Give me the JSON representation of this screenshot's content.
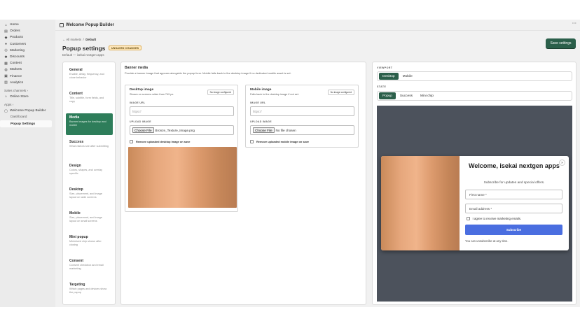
{
  "sidebar": {
    "items": [
      {
        "label": "Home",
        "icon": "home-icon"
      },
      {
        "label": "Orders",
        "icon": "orders-icon"
      },
      {
        "label": "Products",
        "icon": "products-icon"
      },
      {
        "label": "Customers",
        "icon": "customers-icon"
      },
      {
        "label": "Marketing",
        "icon": "marketing-icon"
      },
      {
        "label": "Discounts",
        "icon": "discounts-icon"
      },
      {
        "label": "Content",
        "icon": "content-icon"
      },
      {
        "label": "Markets",
        "icon": "markets-icon"
      },
      {
        "label": "Finance",
        "icon": "finance-icon"
      },
      {
        "label": "Analytics",
        "icon": "analytics-icon"
      }
    ],
    "sales_channels_label": "Sales channels",
    "online_store": "Online Store",
    "apps_label": "Apps",
    "app_name": "Welcome Popup Builder",
    "app_sub": [
      "Dashboard",
      "Popup Settings"
    ]
  },
  "appbar": {
    "title": "Welcome Popup Builder",
    "more": "···"
  },
  "header": {
    "breadcrumb_back": "← All markets",
    "breadcrumb_sep": "/",
    "breadcrumb_current": "Default",
    "title": "Popup settings",
    "unsaved_badge": "UNSAVED CHANGES",
    "subtitle": "Default — isekai nextgen apps",
    "save_label": "Save settings"
  },
  "settings_menu": [
    {
      "title": "General",
      "desc": "Enable, delay, frequency, and close behavior"
    },
    {
      "title": "Content",
      "desc": "Title, subtitle, form fields, and copy"
    },
    {
      "title": "Media",
      "desc": "Banner images for desktop and mobile"
    },
    {
      "title": "Success",
      "desc": "What visitors see after submitting"
    },
    {
      "title": "Design",
      "desc": "Colors, shapes, and overlay specific"
    },
    {
      "title": "Desktop",
      "desc": "Size, placement, and image layout on wide screens"
    },
    {
      "title": "Mobile",
      "desc": "Size, placement, and image layout on small screens"
    },
    {
      "title": "Mini popup",
      "desc": "Minimized chip shown after closing"
    },
    {
      "title": "Consent",
      "desc": "Consent checkbox and email marketing"
    },
    {
      "title": "Targeting",
      "desc": "Which pages and devices show the popup"
    }
  ],
  "media": {
    "title": "Banner media",
    "desc": "Provide a banner image that appears alongside the popup form. Mobile falls back to the desktop image if no dedicated mobile asset is set.",
    "desktop": {
      "title": "Desktop image",
      "desc": "Shown on screens wider than 749 px.",
      "badge": "No image configured",
      "url_label": "IMAGE URL",
      "url_placeholder": "https://",
      "upload_label": "UPLOAD IMAGE",
      "file_button": "Choose File",
      "file_name": "Bronze_Texture_Image.png",
      "remove_label": "Remove uploaded desktop image on save"
    },
    "mobile": {
      "title": "Mobile image",
      "desc": "Falls back to the desktop image if not set.",
      "badge": "No image configured",
      "url_label": "IMAGE URL",
      "url_placeholder": "https://",
      "upload_label": "UPLOAD IMAGE",
      "file_button": "Choose File",
      "file_name": "No file chosen",
      "remove_label": "Remove uploaded mobile image on save"
    }
  },
  "preview": {
    "viewport_label": "VIEWPORT",
    "viewport_options": [
      "Desktop",
      "Mobile"
    ],
    "state_label": "STATE",
    "state_options": [
      "Popup",
      "Success",
      "Mini chip"
    ],
    "popup": {
      "close": "×",
      "title": "Welcome, isekai nextgen apps",
      "subtitle": "Subscribe for updates and special offers.",
      "first_name": "First name *",
      "email": "Email address *",
      "consent": "I agree to receive marketing emails.",
      "button": "Subscribe",
      "unsubscribe": "You can unsubscribe at any time."
    }
  },
  "colors": {
    "primary": "#2b5f4a",
    "menu_active": "#2e7d5a",
    "popup_button": "#4a6ee0",
    "canvas": "#4c525c",
    "unsaved_badge": "#ffe8bd"
  }
}
